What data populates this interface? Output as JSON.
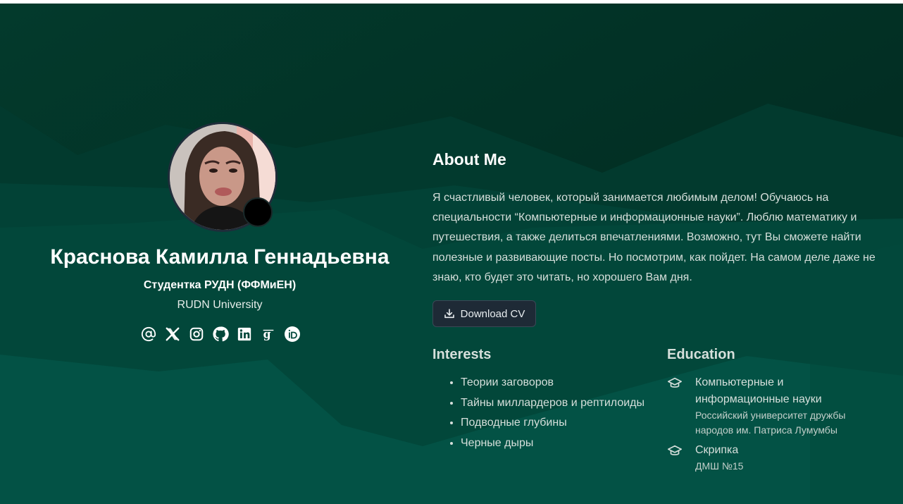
{
  "profile": {
    "name": "Краснова Камилла Геннадьевна",
    "role": "Студентка РУДН (ФФМиЕН)",
    "organization": "RUDN University"
  },
  "social_icons": [
    "at-icon",
    "x-icon",
    "instagram-icon",
    "github-icon",
    "linkedin-icon",
    "google-scholar-icon",
    "orcid-icon"
  ],
  "about": {
    "title": "About Me",
    "text": "Я счастливый человек, который занимается любимым делом! Обучаюсь на специальности “Компьютерные и информационные науки”. Люблю математику и путешествия, а также делиться впечатлениями. Возможно, тут Вы сможете найти полезные и развивающие посты. Но посмотрим, как пойдет. На самом деле даже не знаю, кто будет это читать, но хорошего Вам дня.",
    "download_cv": "Download CV"
  },
  "interests": {
    "title": "Interests",
    "items": [
      "Теории заговоров",
      "Тайны миллардеров и рептилоиды",
      "Подводные глубины",
      "Черные дыры"
    ]
  },
  "education": {
    "title": "Education",
    "items": [
      {
        "degree": "Компьютерные и информационные науки",
        "institution": "Российский университет дружбы народов им. Патриса Лумумбы"
      },
      {
        "degree": "Скрипка",
        "institution": "ДМШ №15"
      }
    ]
  },
  "colors": {
    "background_dark": "#02291f",
    "mountain_mid": "#02473a",
    "mountain_light": "#03574a",
    "button_bg": "#1e2a36"
  }
}
